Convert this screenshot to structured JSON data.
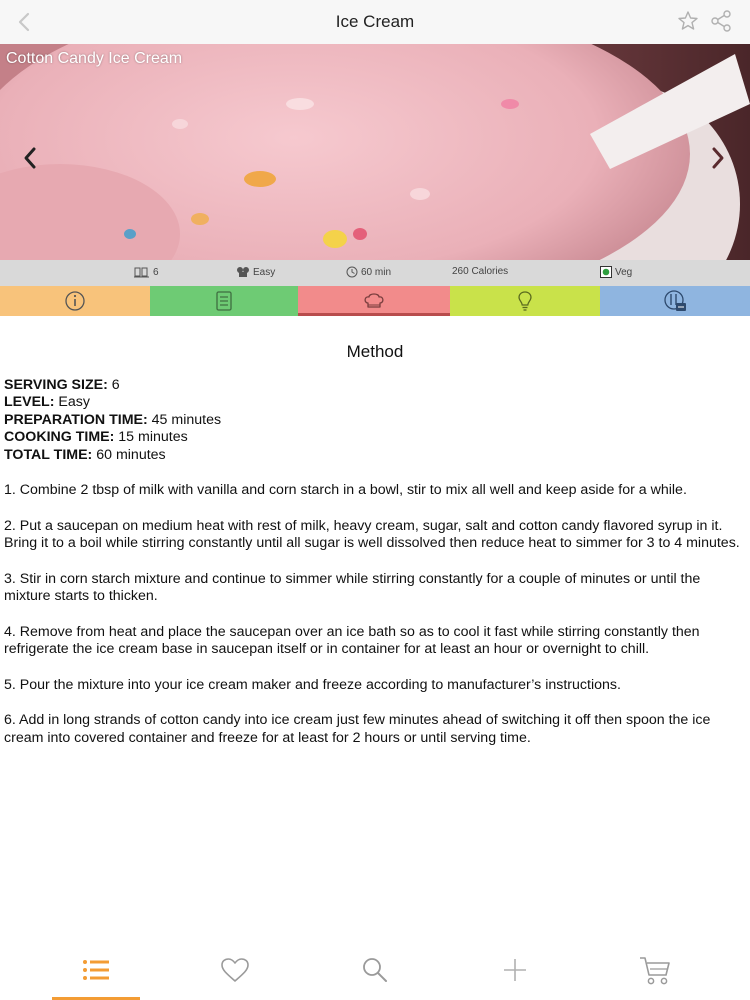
{
  "nav": {
    "title": "Ice Cream"
  },
  "hero": {
    "title": "Cotton Candy Ice Cream"
  },
  "stats": {
    "servings": "6",
    "level": "Easy",
    "time": "60 min",
    "calories": "260 Calories",
    "diet": "Veg"
  },
  "colors": {
    "tab_info": "#f8c37b",
    "tab_ingredients": "#6ecb74",
    "tab_method": "#f28b8b",
    "tab_tips": "#c9e24a",
    "tab_nutrition": "#8fb5e0",
    "accent": "#f39c34",
    "veg": "#2e9e3e"
  },
  "icons": {
    "tabs": [
      "info-icon",
      "ingredients-list-icon",
      "chef-hat-icon",
      "lightbulb-icon",
      "nutrition-icon"
    ],
    "tabbar": [
      "list-icon",
      "heart-icon",
      "search-icon",
      "plus-icon",
      "cart-icon"
    ]
  },
  "method": {
    "heading": "Method",
    "meta": [
      {
        "label": "SERVING SIZE:",
        "value": "6"
      },
      {
        "label": "LEVEL:",
        "value": "Easy"
      },
      {
        "label": "PREPARATION TIME:",
        "value": "45 minutes"
      },
      {
        "label": "COOKING TIME:",
        "value": "15 minutes"
      },
      {
        "label": "TOTAL TIME:",
        "value": "60 minutes"
      }
    ],
    "steps": [
      "1. Combine 2 tbsp of milk with vanilla and corn starch in a bowl, stir to mix all well and keep aside for a while.",
      "2. Put a saucepan on medium heat with rest of milk, heavy cream, sugar, salt and cotton candy flavored syrup in it. Bring it to a boil while stirring constantly until all sugar is well dissolved then reduce heat to simmer for 3 to 4 minutes.",
      "3. Stir in corn starch mixture and continue to simmer while stirring constantly for a couple of minutes or until the mixture starts to thicken.",
      "4. Remove from heat and place the saucepan over an ice bath so as to cool it fast while stirring constantly then refrigerate the ice cream base in saucepan itself or in container for at least an hour or overnight to chill.",
      "5. Pour the mixture into your ice cream maker and freeze according to manufacturer’s instructions.",
      "6. Add in long strands of cotton candy into ice cream just few minutes ahead of switching it off then spoon the ice cream into covered container and freeze for at least for 2 hours or until serving time."
    ]
  }
}
